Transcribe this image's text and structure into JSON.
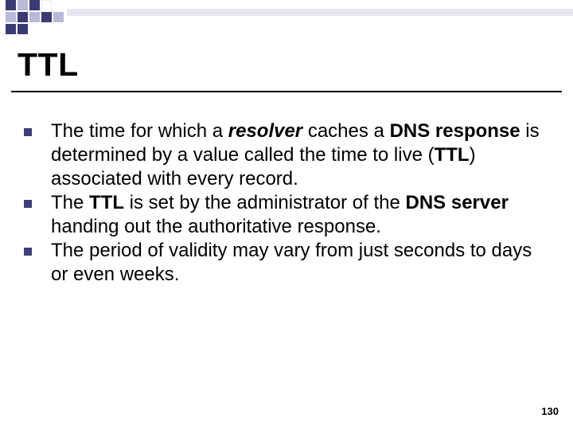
{
  "colors": {
    "accent_dark": "#3a3a75",
    "accent_light": "#b9b9da",
    "white": "#ffffff"
  },
  "title": "TTL",
  "bullets": [
    {
      "pre1": "The time for which a ",
      "bi1": "resolver",
      "mid1": " caches a ",
      "b1": "DNS response",
      "mid2": " is determined by a value called the time to live (",
      "b2": "TTL",
      "post": ") associated with every record."
    },
    {
      "pre1": "The ",
      "b1": "TTL",
      "mid1": " is set by the administrator of the ",
      "b2": "DNS server",
      "post": " handing out the authoritative response."
    },
    {
      "pre1": "The period of validity may vary from just seconds to days or even weeks."
    }
  ],
  "page_number": "130"
}
